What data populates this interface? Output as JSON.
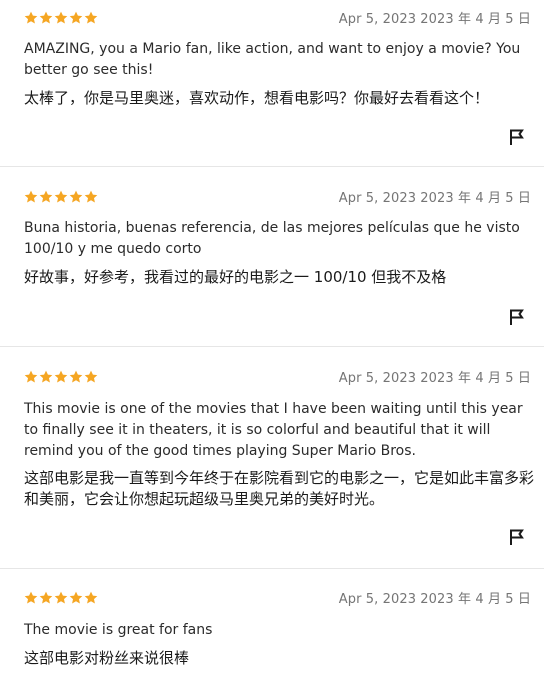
{
  "accent_star_color": "#f5a623",
  "reviews": [
    {
      "rating": 5,
      "date": "Apr 5, 2023 2023 年 4 月 5 日",
      "original": "AMAZING, you a Mario fan, like action, and want to enjoy a movie? You better go see this!",
      "translated": "太棒了，你是马里奥迷，喜欢动作，想看电影吗？你最好去看看这个！",
      "flag_icon": "flag-icon"
    },
    {
      "rating": 5,
      "date": "Apr 5, 2023 2023 年 4 月 5 日",
      "original": "Buna historia, buenas referencia, de las mejores películas que he visto 100/10 y me quedo corto",
      "translated": "好故事，好参考，我看过的最好的电影之一 100/10 但我不及格",
      "flag_icon": "flag-icon"
    },
    {
      "rating": 5,
      "date": "Apr 5, 2023 2023 年 4 月 5 日",
      "original": "This movie is one of the movies that I have been waiting until this year to finally see it in theaters, it is so colorful and beautiful that it will remind you of the good times playing Super Mario Bros.",
      "translated": "这部电影是我一直等到今年终于在影院看到它的电影之一，它是如此丰富多彩和美丽，它会让你想起玩超级马里奥兄弟的美好时光。",
      "flag_icon": "flag-icon"
    },
    {
      "rating": 5,
      "date": "Apr 5, 2023 2023 年 4 月 5 日",
      "original": "The movie is great for fans",
      "translated": "这部电影对粉丝来说很棒",
      "flag_icon": "flag-icon"
    }
  ]
}
